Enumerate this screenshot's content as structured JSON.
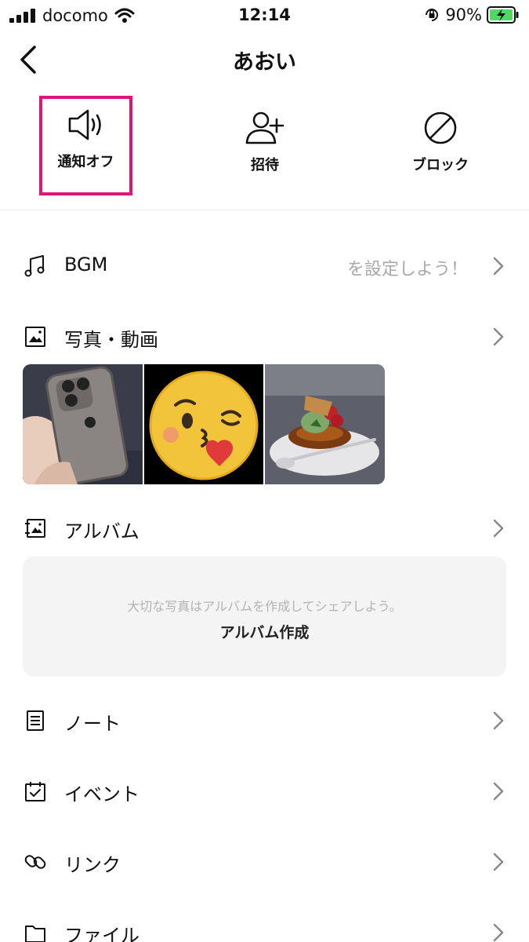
{
  "status_bar": {
    "carrier": "docomo",
    "time": "12:14",
    "battery": "90%"
  },
  "header": {
    "title": "あおい"
  },
  "actions": [
    {
      "label": "通知オフ",
      "highlighted": true
    },
    {
      "label": "招待"
    },
    {
      "label": "ブロック"
    }
  ],
  "menu": {
    "bgm": {
      "label": "BGM",
      "value": "を設定しよう！"
    },
    "photos": {
      "label": "写真・動画"
    },
    "album": {
      "label": "アルバム"
    },
    "note": {
      "label": "ノート"
    },
    "event": {
      "label": "イベント"
    },
    "link": {
      "label": "リンク"
    },
    "file": {
      "label": "ファイル"
    }
  },
  "album_card": {
    "hint": "大切な写真はアルバムを作成してシェアしよう。",
    "create_label": "アルバム作成"
  },
  "colors": {
    "highlight": "#e0157a",
    "card_bg": "#f4f4f4",
    "battery_fill": "#4cd964"
  }
}
